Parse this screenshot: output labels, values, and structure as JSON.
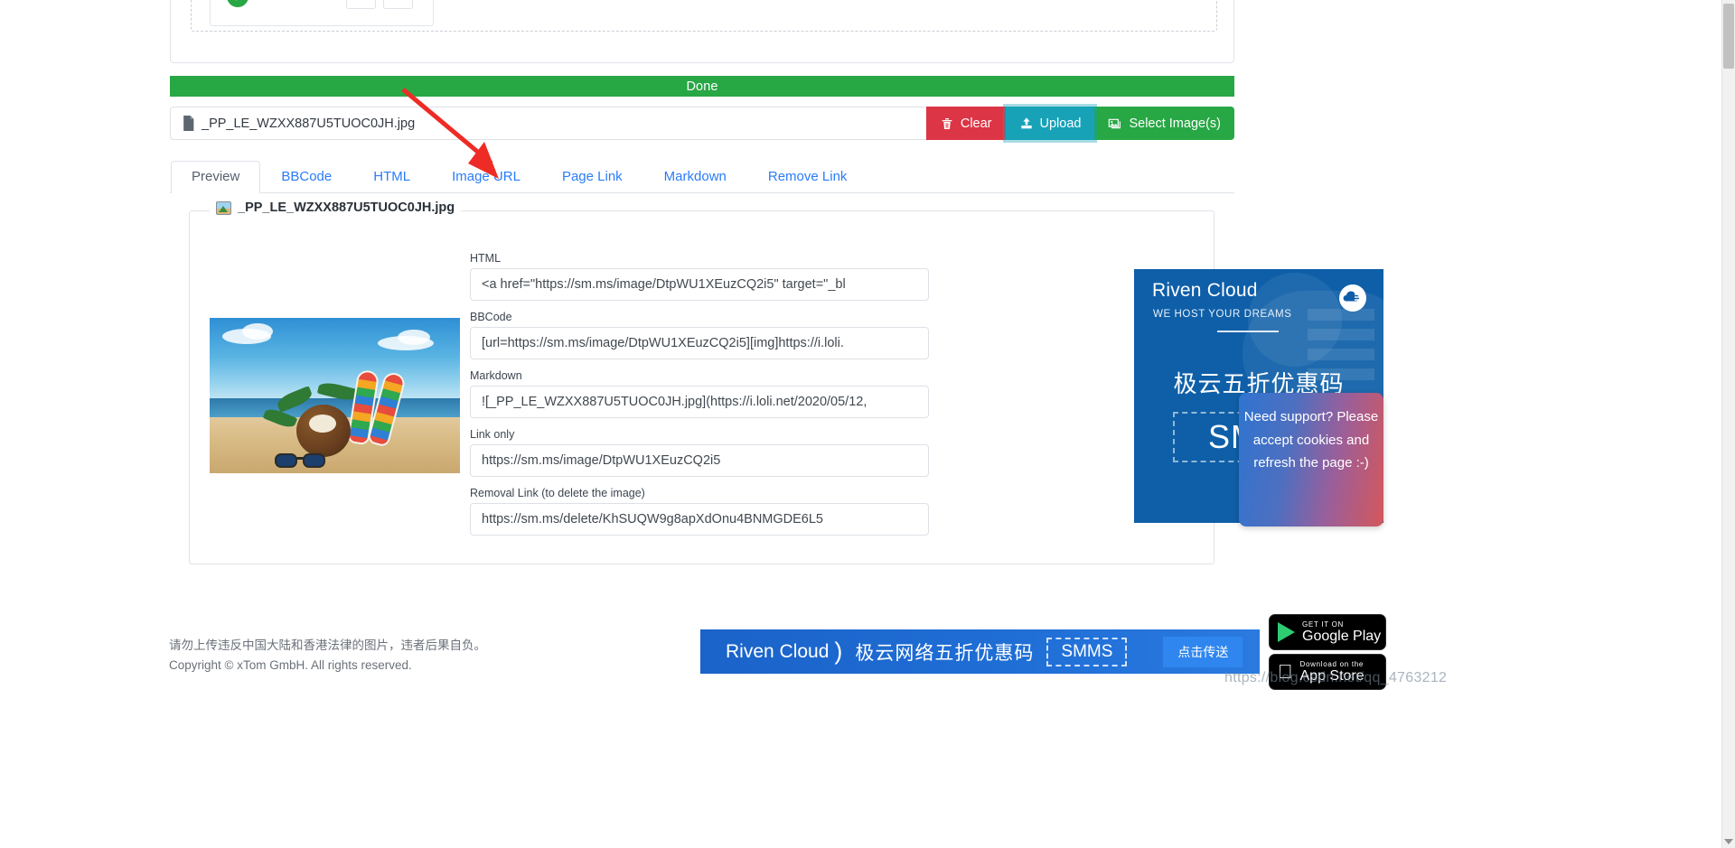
{
  "upload": {
    "status_bar_label": "Done",
    "filename": "_PP_LE_WZXX887U5TUOC0JH.jpg",
    "buttons": {
      "clear": "Clear",
      "upload": "Upload",
      "select": "Select Image(s)"
    },
    "icons": {
      "file": "file-icon",
      "trash": "trash-icon",
      "magnifier": "magnifier-plus-icon",
      "check": "check-circle-icon"
    }
  },
  "tabs": [
    {
      "label": "Preview",
      "active": true
    },
    {
      "label": "BBCode",
      "active": false
    },
    {
      "label": "HTML",
      "active": false
    },
    {
      "label": "Image URL",
      "active": false
    },
    {
      "label": "Page Link",
      "active": false
    },
    {
      "label": "Markdown",
      "active": false
    },
    {
      "label": "Remove Link",
      "active": false
    }
  ],
  "preview": {
    "legend": "_PP_LE_WZXX887U5TUOC0JH.jpg",
    "fields": [
      {
        "label": "HTML",
        "value": "<a href=\"https://sm.ms/image/DtpWU1XEuzCQ2i5\" target=\"_bl"
      },
      {
        "label": "BBCode",
        "value": "[url=https://sm.ms/image/DtpWU1XEuzCQ2i5][img]https://i.loli."
      },
      {
        "label": "Markdown",
        "value": "![_PP_LE_WZXX887U5TUOC0JH.jpg](https://i.loli.net/2020/05/12,"
      },
      {
        "label": "Link only",
        "value": "https://sm.ms/image/DtpWU1XEuzCQ2i5"
      },
      {
        "label": "Removal Link (to delete the image)",
        "value": "https://sm.ms/delete/KhSUQW9g8apXdOnu4BNMGDE6L5"
      }
    ]
  },
  "side_ad": {
    "title": "Riven Cloud",
    "subtitle": "WE HOST YOUR DREAMS",
    "headline": "极云五折优惠码",
    "code": "SMMS"
  },
  "support_bubble": {
    "text": "Need support? Please accept cookies and refresh the page :-)"
  },
  "footer": {
    "notice": "请勿上传违反中国大陆和香港法律的图片，违者后果自负。",
    "copyright": "Copyright © xTom GmbH. All rights reserved."
  },
  "bottom_ad": {
    "brand": "Riven Cloud",
    "headline": "极云网络五折优惠码",
    "code": "SMMS",
    "cta": "点击传送"
  },
  "store_badges": [
    {
      "small": "GET IT ON",
      "big": "Google Play",
      "icon": "google-play-icon"
    },
    {
      "small": "Download on the",
      "big": "App Store",
      "icon": "apple-icon"
    }
  ],
  "watermark": "https://blog.csdn.net/qq_4763212",
  "colors": {
    "success": "#28a745",
    "danger": "#dc3545",
    "info": "#17a2b8",
    "link": "#2a7cf7",
    "ad_blue": "#0f5fa8"
  }
}
